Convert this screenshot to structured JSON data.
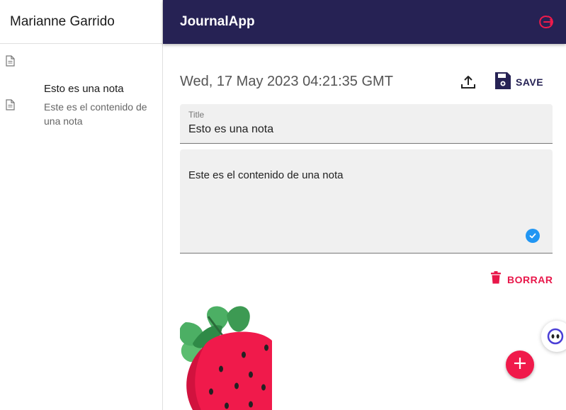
{
  "sidebar": {
    "user_name": "Marianne Garrido",
    "entries": [
      {
        "icon": "document-icon"
      },
      {
        "icon": "document-icon",
        "title": "Esto es una nota",
        "body": "Este es el contenido de una nota"
      }
    ]
  },
  "topbar": {
    "title": "JournalApp",
    "logout_icon": "logout-icon"
  },
  "note": {
    "date": "Wed, 17 May 2023 04:21:35 GMT",
    "save_label": "SAVE",
    "title_label": "Title",
    "title_value": "Esto es una nota",
    "body_value": "Este es el contenido de una nota",
    "delete_label": "BORRAR"
  },
  "colors": {
    "topbar": "#262254",
    "accent": "#f01a4b",
    "delete": "#e8174a",
    "check": "#2196f3"
  }
}
